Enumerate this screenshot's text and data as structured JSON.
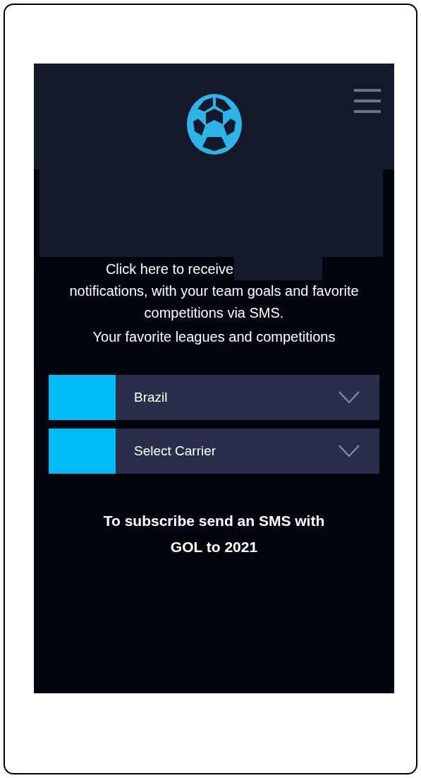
{
  "intro": {
    "line_start": "Click here to receive",
    "line_rest": "notifications, with your team goals and favorite competitions via SMS."
  },
  "subtitle": "Your favorite leagues and competitions",
  "selects": [
    {
      "value": "Brazil"
    },
    {
      "placeholder": "Select Carrier"
    }
  ],
  "footer_text": "To subscribe send an SMS with GOL to 2021"
}
